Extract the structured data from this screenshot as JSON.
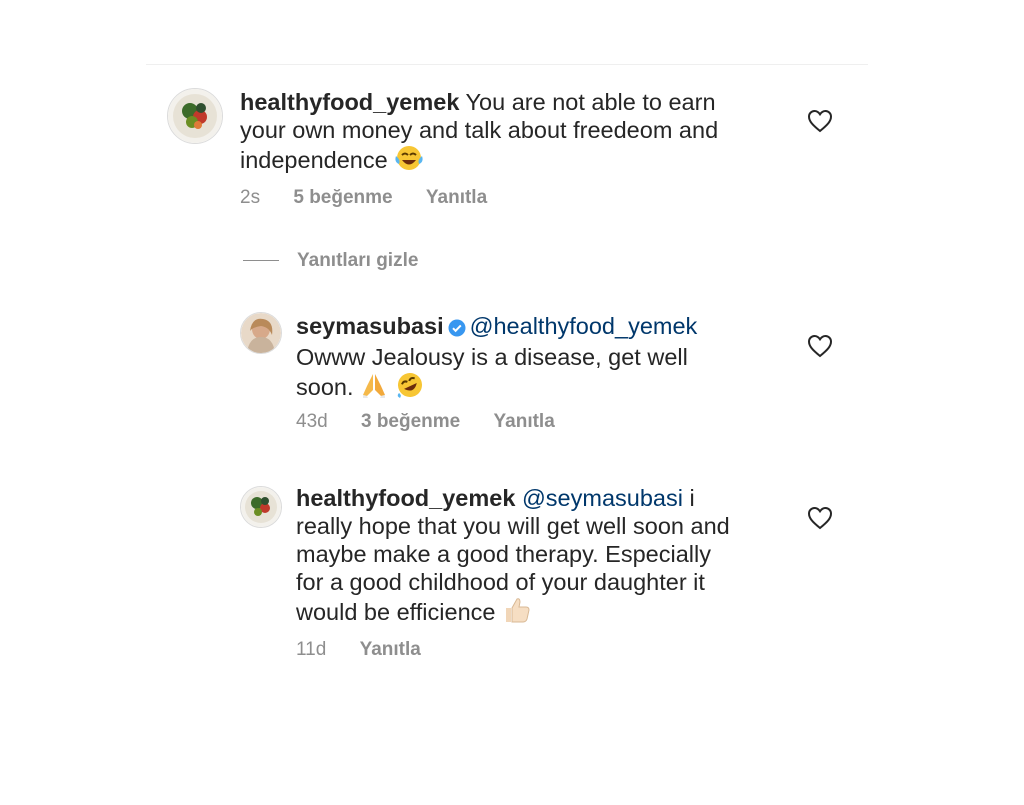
{
  "comments": [
    {
      "username": "healthyfood_yemek",
      "text_lines": [
        "You are not able to earn",
        "your own money and talk about freedeom and",
        "independence"
      ],
      "emoji": "laughing-tears",
      "time": "2s",
      "likes": "5 beğenme",
      "reply": "Yanıtla"
    }
  ],
  "hide_replies": "Yanıtları gizle",
  "replies": [
    {
      "username": "seymasubasi",
      "verified": true,
      "mention": "@healthyfood_yemek",
      "text_lines": [
        "Owww Jealousy is a disease, get well",
        "soon."
      ],
      "time": "43d",
      "likes": "3 beğenme",
      "reply": "Yanıtla"
    },
    {
      "username": "healthyfood_yemek",
      "mention": "@seymasubasi",
      "text_lines": [
        "i",
        "really hope that you will get well soon and",
        "maybe make a good therapy. Especially",
        "for a good childhood of your daughter it",
        "would be efficience"
      ],
      "time": "11d",
      "reply": "Yanıtla"
    }
  ],
  "colors": {
    "text": "#262626",
    "meta": "#8e8e8e",
    "mention": "#00376b",
    "verified": "#3897f0"
  }
}
